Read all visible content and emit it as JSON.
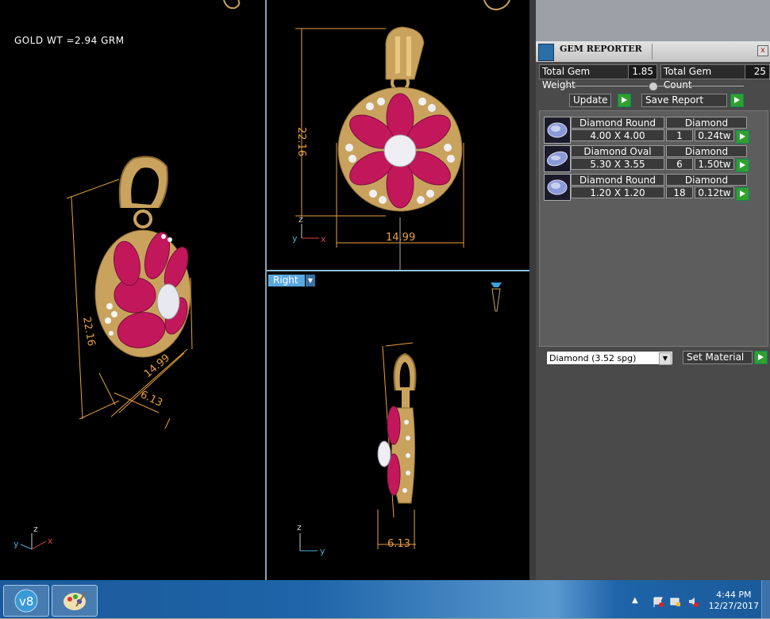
{
  "viewports": {
    "perspective": {
      "gold_weight": "GOLD  WT =2.94  GRM",
      "dims": [
        "22.16",
        "14.99",
        "6.13"
      ],
      "axes": [
        "y",
        "z",
        "x"
      ]
    },
    "front": {
      "dims": [
        "22.16",
        "14.99"
      ],
      "axes": [
        "y",
        "z",
        "x"
      ]
    },
    "right": {
      "view_label": "Right",
      "dims": [
        "6.13"
      ],
      "axes": [
        "y",
        "z"
      ]
    }
  },
  "gem_reporter": {
    "title": "GEM REPORTER",
    "close": "x",
    "total_weight_label": "Total Gem Weight",
    "total_weight_value": "1.85",
    "total_count_label": "Total Gem Count",
    "total_count_value": "25",
    "update_label": "Update",
    "save_label": "Save Report",
    "gems": [
      {
        "name": "Diamond Round",
        "size": "4.00 X 4.00",
        "material": "Diamond",
        "count": "1",
        "weight": "0.24tw"
      },
      {
        "name": "Diamond Oval",
        "size": "5.30 X 3.55",
        "material": "Diamond",
        "count": "6",
        "weight": "1.50tw"
      },
      {
        "name": "Diamond Round",
        "size": "1.20 X 1.20",
        "material": "Diamond",
        "count": "18",
        "weight": "0.12tw"
      }
    ],
    "material_select": "Diamond     (3.52 spg)",
    "set_material_label": "Set Material"
  },
  "taskbar": {
    "time": "4:44 PM",
    "date": "12/27/2017",
    "app1_icon": "v8-app-icon",
    "app2_icon": "paint-icon"
  }
}
